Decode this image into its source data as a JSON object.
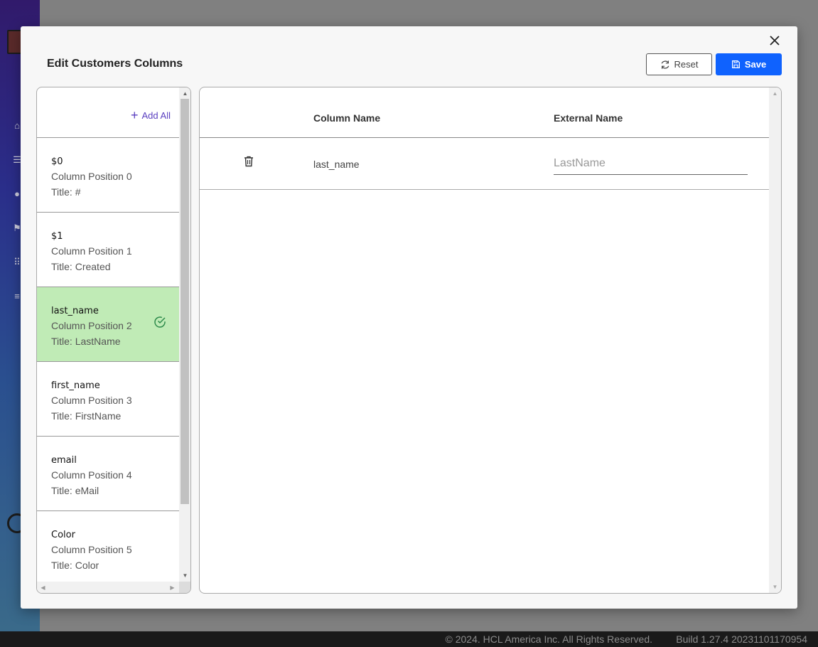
{
  "modal": {
    "title": "Edit Customers Columns",
    "reset_label": "Reset",
    "save_label": "Save",
    "add_all_label": "Add All"
  },
  "columns": [
    {
      "name": "$0",
      "position": "Column Position 0",
      "title": "Title: #",
      "selected": false
    },
    {
      "name": "$1",
      "position": "Column Position 1",
      "title": "Title: Created",
      "selected": false
    },
    {
      "name": "last_name",
      "position": "Column Position 2",
      "title": "Title: LastName",
      "selected": true
    },
    {
      "name": "first_name",
      "position": "Column Position 3",
      "title": "Title: FirstName",
      "selected": false
    },
    {
      "name": "email",
      "position": "Column Position 4",
      "title": "Title: eMail",
      "selected": false
    },
    {
      "name": "Color",
      "position": "Column Position 5",
      "title": "Title: Color",
      "selected": false
    }
  ],
  "table": {
    "headers": {
      "column_name": "Column Name",
      "external_name": "External Name"
    },
    "rows": [
      {
        "column_name": "last_name",
        "external_placeholder": "LastName"
      }
    ]
  },
  "footer": {
    "copyright": "© 2024. HCL America Inc. All Rights Reserved.",
    "build": "Build 1.27.4 20231101170954"
  },
  "colors": {
    "accent": "#0f62fe",
    "selected_row": "#c0ebb6",
    "add_all": "#5a3fc0"
  }
}
